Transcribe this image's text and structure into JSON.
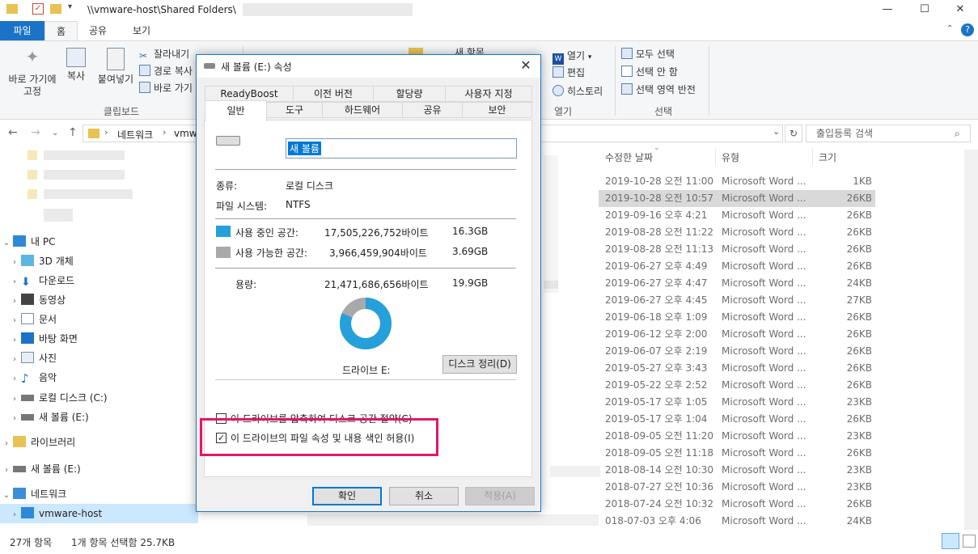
{
  "window": {
    "path": "\\\\vmware-host\\Shared Folders\\",
    "min": "—",
    "max": "☐",
    "close": "✕"
  },
  "ribbon_tabs": [
    "파일",
    "홈",
    "공유",
    "보기"
  ],
  "ribbon": {
    "pin": "바로 가기에\n고정",
    "copy": "복사",
    "paste": "붙여넣기",
    "cut": "잘라내기",
    "copy_path": "경로 복사",
    "paste_shortcut": "바로 가기",
    "clipboard_group": "클립보드",
    "new_item": "새 항목",
    "open": "열기",
    "edit": "편집",
    "history": "히스토리",
    "open_group": "열기",
    "select_all": "모두 선택",
    "select_none": "선택 안 함",
    "invert": "선택 영역 반전",
    "select_group": "선택"
  },
  "address": {
    "crumbs": [
      "네트워크",
      "vmwa"
    ],
    "search_placeholder": "출입등록 검색"
  },
  "nav": {
    "mypc": "내 PC",
    "objects3d": "3D 개체",
    "downloads": "다운로드",
    "videos": "동영상",
    "documents": "문서",
    "desktop": "바탕 화면",
    "pictures": "사진",
    "music": "음악",
    "local_disk": "로컬 디스크 (C:)",
    "new_volume": "새 볼륨 (E:)",
    "library": "라이브러리",
    "new_volume2": "새 볼륨 (E:)",
    "network": "네트워크",
    "vmware_host": "vmware-host"
  },
  "columns": {
    "modified": "수정한 날짜",
    "type": "유형",
    "size": "크기"
  },
  "files": [
    {
      "date": "2019-10-28 오전 11:00",
      "type": "Microsoft Word ...",
      "size": "1KB"
    },
    {
      "date": "2019-10-28 오전 10:57",
      "type": "Microsoft Word ...",
      "size": "26KB",
      "selected": true
    },
    {
      "date": "2019-09-16 오후 4:21",
      "type": "Microsoft Word ...",
      "size": "26KB"
    },
    {
      "date": "2019-08-28 오전 11:22",
      "type": "Microsoft Word ...",
      "size": "26KB"
    },
    {
      "date": "2019-08-28 오전 11:13",
      "type": "Microsoft Word ...",
      "size": "26KB"
    },
    {
      "date": "2019-06-27 오후 4:49",
      "type": "Microsoft Word ...",
      "size": "26KB"
    },
    {
      "date": "2019-06-27 오후 4:47",
      "type": "Microsoft Word ...",
      "size": "24KB"
    },
    {
      "date": "2019-06-27 오후 4:45",
      "type": "Microsoft Word ...",
      "size": "27KB"
    },
    {
      "date": "2019-06-18 오후 1:09",
      "type": "Microsoft Word ...",
      "size": "26KB"
    },
    {
      "date": "2019-06-12 오후 2:00",
      "type": "Microsoft Word ...",
      "size": "26KB"
    },
    {
      "date": "2019-06-07 오후 2:19",
      "type": "Microsoft Word ...",
      "size": "26KB"
    },
    {
      "date": "2019-05-27 오후 3:43",
      "type": "Microsoft Word ...",
      "size": "26KB"
    },
    {
      "date": "2019-05-22 오후 2:52",
      "type": "Microsoft Word ...",
      "size": "26KB"
    },
    {
      "date": "2019-05-17 오후 1:05",
      "type": "Microsoft Word ...",
      "size": "23KB"
    },
    {
      "date": "2019-05-17 오후 1:04",
      "type": "Microsoft Word ...",
      "size": "26KB"
    },
    {
      "date": "2018-09-05 오전 11:20",
      "type": "Microsoft Word ...",
      "size": "23KB"
    },
    {
      "date": "2018-09-05 오전 11:18",
      "type": "Microsoft Word ...",
      "size": "26KB"
    },
    {
      "date": "2018-08-14 오전 10:30",
      "type": "Microsoft Word ...",
      "size": "23KB"
    },
    {
      "date": "2018-07-27 오전 10:36",
      "type": "Microsoft Word ...",
      "size": "23KB"
    },
    {
      "date": "2018-07-24 오전 10:32",
      "type": "Microsoft Word ...",
      "size": "26KB"
    },
    {
      "date": "018-07-03 오후 4:06",
      "type": "Microsoft Word ...",
      "size": "24KB"
    }
  ],
  "status": {
    "count": "27개 항목",
    "selected": "1개 항목 선택함 25.7KB"
  },
  "dialog": {
    "title": "새 볼륨 (E:) 속성",
    "tabs_row1": [
      "ReadyBoost",
      "이전 버전",
      "할당량",
      "사용자 지정"
    ],
    "tabs_row2": [
      "일반",
      "도구",
      "하드웨어",
      "공유",
      "보안"
    ],
    "volume_name": "새 볼륨",
    "type_label": "종류:",
    "type_value": "로컬 디스크",
    "fs_label": "파일 시스템:",
    "fs_value": "NTFS",
    "used_label": "사용 중인 공간:",
    "used_bytes": "17,505,226,752바이트",
    "used_gb": "16.3GB",
    "free_label": "사용 가능한 공간:",
    "free_bytes": "3,966,459,904바이트",
    "free_gb": "3.69GB",
    "cap_label": "용량:",
    "cap_bytes": "21,471,686,656바이트",
    "cap_gb": "19.9GB",
    "used_fraction": 0.815,
    "used_color": "#26a0da",
    "free_color": "#a9a9a9",
    "drive_label": "드라이브 E:",
    "cleanup": "디스크 정리(D)",
    "compress": "이 드라이브를 압축하여 디스크 공간 절약(C)",
    "index": "이 드라이브의 파일 속성 및 내용 색인 허용(I)",
    "ok": "확인",
    "cancel": "취소",
    "apply": "적용(A)"
  }
}
